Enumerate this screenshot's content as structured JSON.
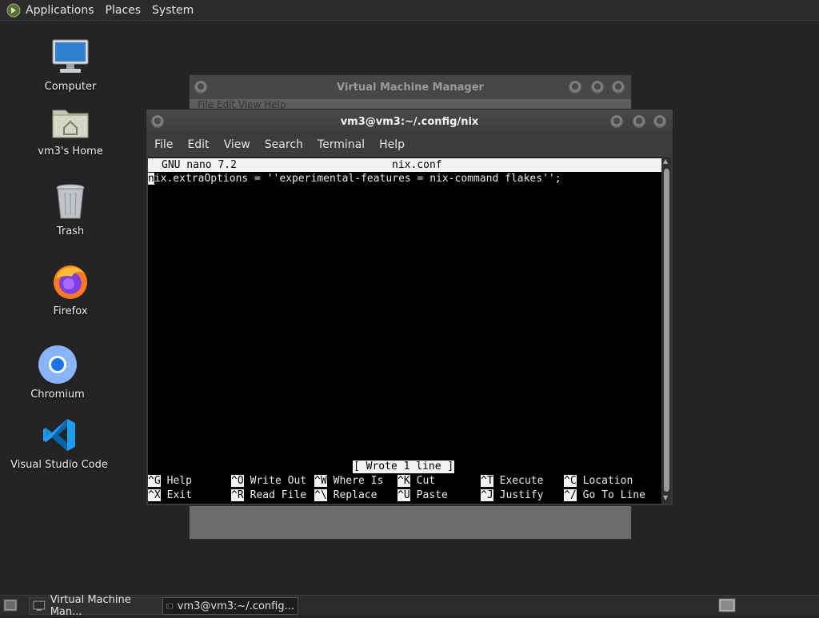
{
  "top_panel": {
    "menu": [
      "Applications",
      "Places",
      "System"
    ]
  },
  "desktop": {
    "icons": [
      {
        "label": "Computer",
        "icon": "computer-icon"
      },
      {
        "label": "vm3's Home",
        "icon": "home-folder-icon"
      },
      {
        "label": "Trash",
        "icon": "trash-icon"
      },
      {
        "label": "Firefox",
        "icon": "firefox-icon"
      },
      {
        "label": "Chromium",
        "icon": "chromium-icon"
      },
      {
        "label": "Visual Studio Code",
        "icon": "vscode-icon"
      }
    ]
  },
  "vmm_window": {
    "title": "Virtual Machine Manager",
    "menubar_partial": "File   Edit   View   Help"
  },
  "terminal": {
    "title": "vm3@vm3:~/.config/nix",
    "menu": [
      "File",
      "Edit",
      "View",
      "Search",
      "Terminal",
      "Help"
    ],
    "nano": {
      "version": "GNU nano 7.2",
      "filename": "nix.conf",
      "cursor_char": "n",
      "line_rest": "ix.extraOptions = ''experimental-features = nix-command flakes'';",
      "status": "[ Wrote 1 line ]",
      "shortcuts_row1": [
        {
          "key": "^G",
          "desc": "Help"
        },
        {
          "key": "^O",
          "desc": "Write Out"
        },
        {
          "key": "^W",
          "desc": "Where Is"
        },
        {
          "key": "^K",
          "desc": "Cut"
        },
        {
          "key": "^T",
          "desc": "Execute"
        },
        {
          "key": "^C",
          "desc": "Location"
        }
      ],
      "shortcuts_row2": [
        {
          "key": "^X",
          "desc": "Exit"
        },
        {
          "key": "^R",
          "desc": "Read File"
        },
        {
          "key": "^\\",
          "desc": "Replace"
        },
        {
          "key": "^U",
          "desc": "Paste"
        },
        {
          "key": "^J",
          "desc": "Justify"
        },
        {
          "key": "^/",
          "desc": "Go To Line"
        }
      ]
    }
  },
  "taskbar": {
    "tasks": [
      {
        "label": "Virtual Machine Man...",
        "active": false
      },
      {
        "label": "vm3@vm3:~/.config...",
        "active": true
      }
    ]
  },
  "colors": {
    "desktop_bg": "#242424",
    "terminal_bg": "#000000",
    "nano_bar": "#f2f2f2"
  }
}
